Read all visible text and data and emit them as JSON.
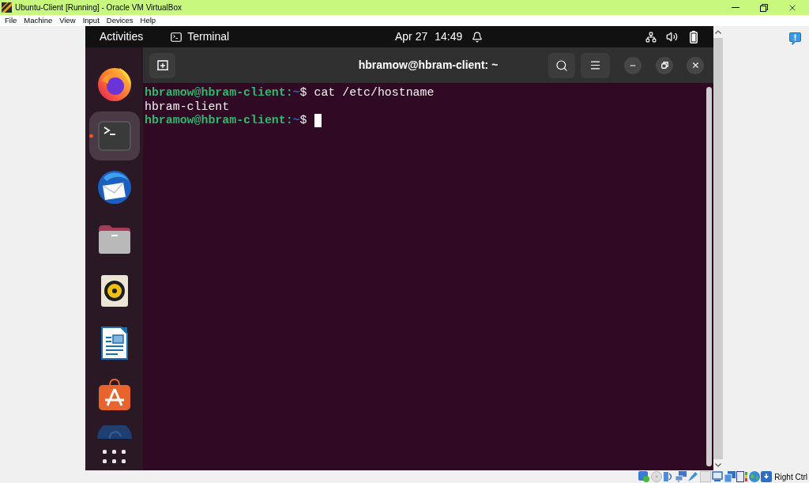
{
  "window": {
    "title": "Ubuntu-Client [Running] - Oracle VM VirtualBox"
  },
  "menu_bar": {
    "items": [
      "File",
      "Machine",
      "View",
      "Input",
      "Devices",
      "Help"
    ]
  },
  "guest": {
    "top_bar": {
      "activities": "Activities",
      "focused_app": "Terminal",
      "date": "Apr 27",
      "time": "14:49"
    },
    "dock": {
      "items": [
        {
          "kind": "browser",
          "selected": false,
          "running": false
        },
        {
          "kind": "terminal",
          "selected": true,
          "running": true
        },
        {
          "kind": "mail",
          "selected": false,
          "running": false
        },
        {
          "kind": "files",
          "selected": false,
          "running": false
        },
        {
          "kind": "music",
          "selected": false,
          "running": false
        },
        {
          "kind": "writer",
          "selected": false,
          "running": false
        },
        {
          "kind": "software",
          "selected": false,
          "running": false
        },
        {
          "kind": "disc",
          "selected": false,
          "running": false
        }
      ]
    },
    "terminal": {
      "title": "hbramow@hbram-client: ~",
      "lines": [
        {
          "kind": "prompt",
          "user_host": "hbramow@hbram-client:",
          "cwd": "~",
          "sign": "$",
          "command": "cat /etc/hostname",
          "cursor": false
        },
        {
          "kind": "output",
          "text": "hbram-client"
        },
        {
          "kind": "prompt",
          "user_host": "hbramow@hbram-client:",
          "cwd": "~",
          "sign": "$",
          "cursor": true
        }
      ]
    }
  },
  "status_bar": {
    "host_key": "Right Ctrl"
  }
}
